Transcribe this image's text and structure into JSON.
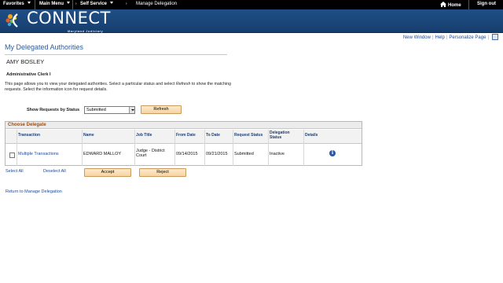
{
  "topnav": {
    "favorites": "Favorites",
    "main_menu": "Main Menu",
    "self_service": "Self Service",
    "breadcrumb_current": "Manage Delegation",
    "home": "Home",
    "sign_out": "Sign out"
  },
  "banner": {
    "brand": "CONNECT",
    "tagline": "Maryland Judiciary"
  },
  "pagebar": {
    "new_window": "New Window",
    "help": "Help",
    "personalize": "Personalize Page"
  },
  "page": {
    "title": "My Delegated Authorities",
    "person": "AMY BOSLEY",
    "role": "Administrative Clerk I",
    "instructions_1": "This page allows you to view your delegated authorities. Select a particular status and select ",
    "instructions_em": "Refresh",
    "instructions_2": " to show the matching requests. Select the information icon for request details."
  },
  "filter": {
    "label": "Show Requests by Status",
    "selected": "Submitted",
    "refresh_label": "Refresh"
  },
  "grid": {
    "title": "Choose Delegate",
    "columns": [
      "Transaction",
      "Name",
      "Job Title",
      "From Date",
      "To Date",
      "Request Status",
      "Delegation Status",
      "Details"
    ],
    "rows": [
      {
        "transaction": "Multiple Transactions",
        "name": "EDWARD MALLOY",
        "job_title": "Judge - District Court",
        "from_date": "09/14/2015",
        "to_date": "09/21/2015",
        "request_status": "Submitted",
        "delegation_status": "Inactive",
        "details_icon": "info-icon"
      }
    ]
  },
  "actions": {
    "select_all": "Select All",
    "deselect_all": "Deselect All",
    "accept": "Accept",
    "reject": "Reject",
    "return_link": "Return to Manage Delegation"
  },
  "colors": {
    "banner": "#1f4f86",
    "link": "#1a4a9a",
    "title": "#2e5b97",
    "grid_title": "#a24d0a",
    "button": "#f7d4a1"
  }
}
